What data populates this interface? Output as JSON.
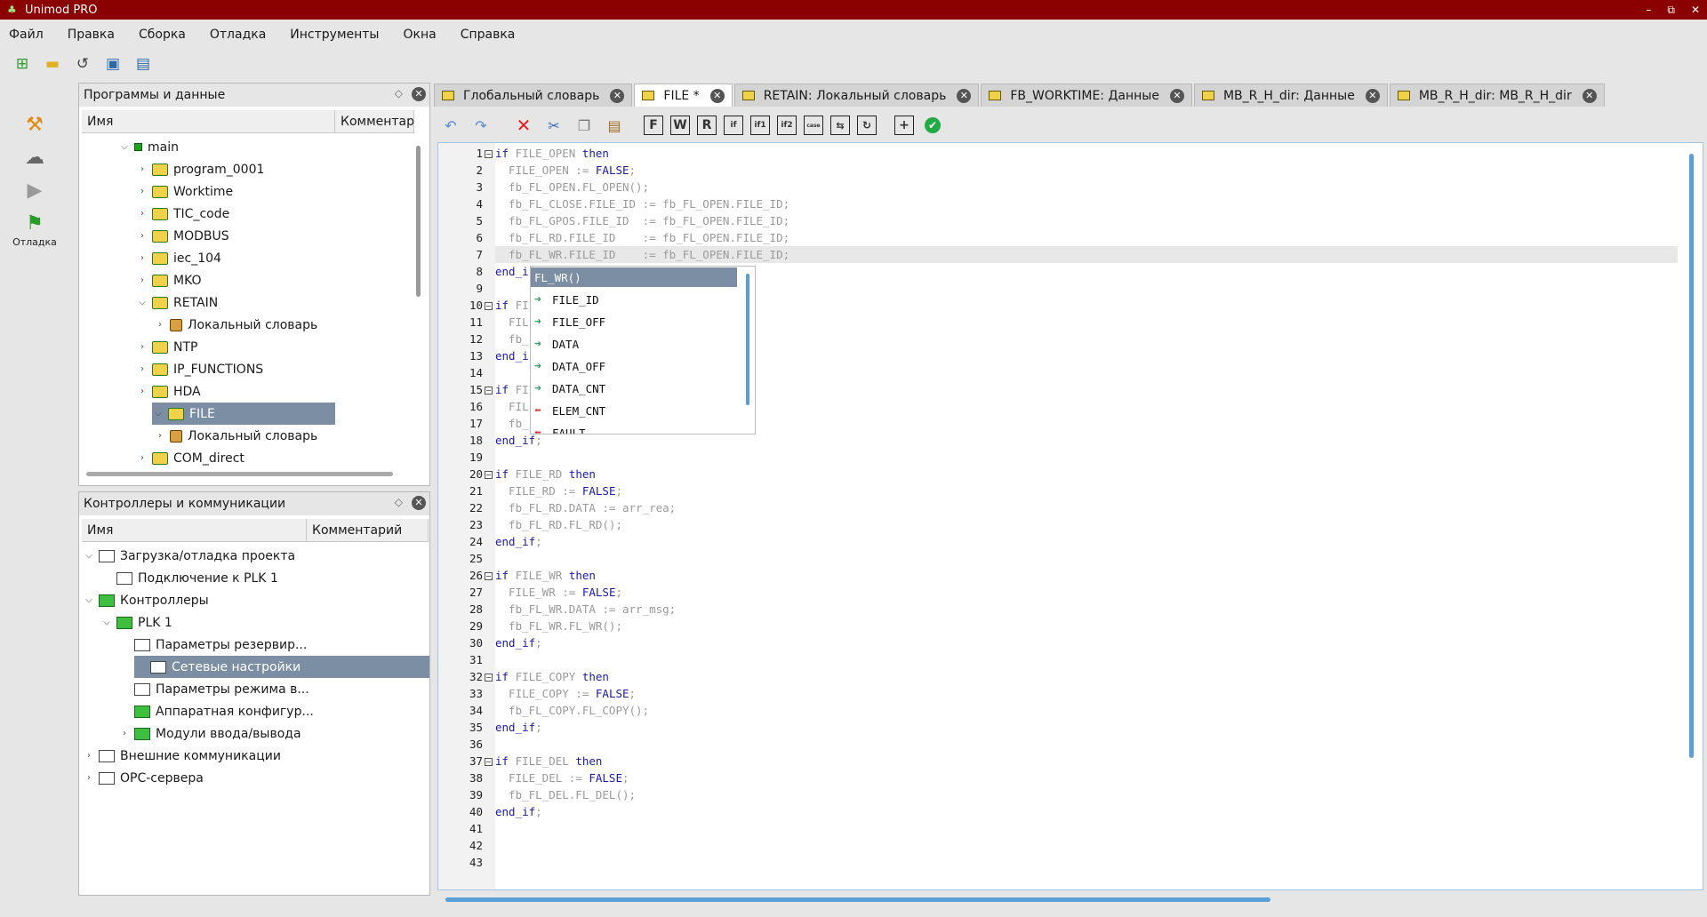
{
  "window": {
    "title": "Unimod PRO",
    "controls": [
      "–",
      "⧉",
      "✕"
    ]
  },
  "menu": [
    "Файл",
    "Правка",
    "Сборка",
    "Отладка",
    "Инструменты",
    "Окна",
    "Справка"
  ],
  "toolbar": {
    "icons": [
      "new-icon",
      "open-folder-icon",
      "history-icon",
      "save-icon",
      "save-all-icon"
    ]
  },
  "leftbar": {
    "debug_label": "Отладка"
  },
  "programs_panel": {
    "title": "Программы и данные",
    "col_name": "Имя",
    "col_comment": "Комментарий",
    "items": [
      {
        "label": "main",
        "level": 0,
        "expanded": true,
        "icon": "green-square"
      },
      {
        "label": "program_0001",
        "level": 1,
        "expanded": false,
        "icon": "folder"
      },
      {
        "label": "Worktime",
        "level": 1,
        "expanded": false,
        "icon": "folder"
      },
      {
        "label": "TIC_code",
        "level": 1,
        "expanded": false,
        "icon": "folder"
      },
      {
        "label": "MODBUS",
        "level": 1,
        "expanded": false,
        "icon": "folder"
      },
      {
        "label": "iec_104",
        "level": 1,
        "expanded": false,
        "icon": "folder"
      },
      {
        "label": "MKO",
        "level": 1,
        "expanded": false,
        "icon": "folder"
      },
      {
        "label": "RETAIN",
        "level": 1,
        "expanded": true,
        "icon": "folder"
      },
      {
        "label": "Локальный словарь",
        "level": 2,
        "expanded": false,
        "icon": "dict"
      },
      {
        "label": "NTP",
        "level": 1,
        "expanded": false,
        "icon": "folder"
      },
      {
        "label": "IP_FUNCTIONS",
        "level": 1,
        "expanded": false,
        "icon": "folder"
      },
      {
        "label": "HDA",
        "level": 1,
        "expanded": false,
        "icon": "folder"
      },
      {
        "label": "FILE",
        "level": 1,
        "expanded": true,
        "icon": "folder",
        "selected": true
      },
      {
        "label": "Локальный словарь",
        "level": 2,
        "expanded": false,
        "icon": "dict"
      },
      {
        "label": "COM_direct",
        "level": 1,
        "expanded": false,
        "icon": "folder"
      }
    ]
  },
  "controllers_panel": {
    "title": "Контроллеры и коммуникации",
    "col_name": "Имя",
    "col_comment": "Комментарий",
    "items": [
      {
        "label": "Загрузка/отладка проекта",
        "level": 0,
        "expanded": true,
        "icon": "doc"
      },
      {
        "label": "Подключение к PLK 1",
        "level": 1,
        "icon": "doc"
      },
      {
        "label": "Контроллеры",
        "level": 0,
        "expanded": true,
        "icon": "green"
      },
      {
        "label": "PLK 1",
        "level": 1,
        "expanded": true,
        "icon": "green"
      },
      {
        "label": "Параметры резервир...",
        "level": 2,
        "icon": "doc"
      },
      {
        "label": "Сетевые настройки",
        "level": 2,
        "icon": "doc",
        "selected": true
      },
      {
        "label": "Параметры режима в...",
        "level": 2,
        "icon": "doc"
      },
      {
        "label": "Аппаратная конфигур...",
        "level": 2,
        "icon": "green"
      },
      {
        "label": "Модули ввода/вывода",
        "level": 2,
        "expanded": false,
        "icon": "green"
      },
      {
        "label": "Внешние коммуникации",
        "level": 0,
        "expanded": false,
        "icon": "doc"
      },
      {
        "label": "OPC-сервера",
        "level": 0,
        "expanded": false,
        "icon": "doc"
      }
    ]
  },
  "tabs": [
    {
      "label": "Глобальный словарь",
      "active": false
    },
    {
      "label": "FILE *",
      "active": true
    },
    {
      "label": "RETAIN: Локальный словарь",
      "active": false
    },
    {
      "label": "FB_WORKTIME: Данные",
      "active": false
    },
    {
      "label": "MB_R_H_dir: Данные",
      "active": false
    },
    {
      "label": "MB_R_H_dir: MB_R_H_dir",
      "active": false
    }
  ],
  "editor_toolbar": [
    "undo-icon",
    "redo-icon",
    "delete-icon",
    "cut-icon",
    "copy-icon",
    "paste-icon",
    "F",
    "W",
    "R",
    "if",
    "if1",
    "if2",
    "case",
    "loop",
    "repeat",
    "add-icon",
    "check-icon"
  ],
  "code": [
    {
      "n": "1",
      "t": [
        [
          "kw",
          "if"
        ],
        [
          "",
          "FILE_OPEN "
        ],
        [
          "kw",
          "then"
        ]
      ],
      "fold": true
    },
    {
      "n": "2",
      "t": [
        [
          "",
          "  FILE_OPEN := "
        ],
        [
          "kw",
          "FALSE"
        ],
        [
          "",
          ";"
        ]
      ]
    },
    {
      "n": "3",
      "t": [
        [
          "",
          "  fb_FL_OPEN.FL_OPEN();"
        ]
      ]
    },
    {
      "n": "4",
      "t": [
        [
          "",
          "  fb_FL_CLOSE.FILE_ID := fb_FL_OPEN.FILE_ID;"
        ]
      ]
    },
    {
      "n": "5",
      "t": [
        [
          "",
          "  fb_FL_GPOS.FILE_ID  := fb_FL_OPEN.FILE_ID;"
        ]
      ]
    },
    {
      "n": "6",
      "t": [
        [
          "",
          "  fb_FL_RD.FILE_ID    := fb_FL_OPEN.FILE_ID;"
        ]
      ]
    },
    {
      "n": "7",
      "t": [
        [
          "",
          "  fb_FL_WR.FILE_ID    := fb_FL_OPEN.FILE_ID;"
        ]
      ],
      "hl": true
    },
    {
      "n": "8",
      "t": [
        [
          "kw",
          "end_i"
        ]
      ]
    },
    {
      "n": "9",
      "t": []
    },
    {
      "n": "10",
      "t": [
        [
          "kw",
          "if"
        ],
        [
          "",
          "FI"
        ]
      ],
      "fold": true
    },
    {
      "n": "11",
      "t": [
        [
          "",
          "  FIL"
        ]
      ]
    },
    {
      "n": "12",
      "t": [
        [
          "",
          "  fb_"
        ]
      ]
    },
    {
      "n": "13",
      "t": [
        [
          "kw",
          "end_i"
        ]
      ]
    },
    {
      "n": "14",
      "t": []
    },
    {
      "n": "15",
      "t": [
        [
          "kw",
          "if"
        ],
        [
          "",
          "FI"
        ]
      ],
      "fold": true
    },
    {
      "n": "16",
      "t": [
        [
          "",
          "  FIL"
        ]
      ]
    },
    {
      "n": "17",
      "t": [
        [
          "",
          "  fb_"
        ]
      ]
    },
    {
      "n": "18",
      "t": [
        [
          "kw",
          "end_if"
        ],
        [
          "",
          ";"
        ]
      ]
    },
    {
      "n": "19",
      "t": []
    },
    {
      "n": "20",
      "t": [
        [
          "kw",
          "if"
        ],
        [
          "",
          "FILE_RD "
        ],
        [
          "kw",
          "then"
        ]
      ],
      "fold": true
    },
    {
      "n": "21",
      "t": [
        [
          "",
          "  FILE_RD := "
        ],
        [
          "kw",
          "FALSE"
        ],
        [
          "",
          ";"
        ]
      ]
    },
    {
      "n": "22",
      "t": [
        [
          "",
          "  fb_FL_RD.DATA := arr_rea;"
        ]
      ]
    },
    {
      "n": "23",
      "t": [
        [
          "",
          "  fb_FL_RD.FL_RD();"
        ]
      ]
    },
    {
      "n": "24",
      "t": [
        [
          "kw",
          "end_if"
        ],
        [
          "",
          ";"
        ]
      ]
    },
    {
      "n": "25",
      "t": []
    },
    {
      "n": "26",
      "t": [
        [
          "kw",
          "if"
        ],
        [
          "",
          "FILE_WR "
        ],
        [
          "kw",
          "then"
        ]
      ],
      "fold": true
    },
    {
      "n": "27",
      "t": [
        [
          "",
          "  FILE_WR := "
        ],
        [
          "kw",
          "FALSE"
        ],
        [
          "",
          ";"
        ]
      ]
    },
    {
      "n": "28",
      "t": [
        [
          "",
          "  fb_FL_WR.DATA := arr_msg;"
        ]
      ]
    },
    {
      "n": "29",
      "t": [
        [
          "",
          "  fb_FL_WR.FL_WR();"
        ]
      ]
    },
    {
      "n": "30",
      "t": [
        [
          "kw",
          "end_if"
        ],
        [
          "",
          ";"
        ]
      ]
    },
    {
      "n": "31",
      "t": []
    },
    {
      "n": "32",
      "t": [
        [
          "kw",
          "if"
        ],
        [
          "",
          "FILE_COPY "
        ],
        [
          "kw",
          "then"
        ]
      ],
      "fold": true
    },
    {
      "n": "33",
      "t": [
        [
          "",
          "  FILE_COPY := "
        ],
        [
          "kw",
          "FALSE"
        ],
        [
          "",
          ";"
        ]
      ]
    },
    {
      "n": "34",
      "t": [
        [
          "",
          "  fb_FL_COPY.FL_COPY();"
        ]
      ]
    },
    {
      "n": "35",
      "t": [
        [
          "kw",
          "end_if"
        ],
        [
          "",
          ";"
        ]
      ]
    },
    {
      "n": "36",
      "t": []
    },
    {
      "n": "37",
      "t": [
        [
          "kw",
          "if"
        ],
        [
          "",
          "FILE_DEL "
        ],
        [
          "kw",
          "then"
        ]
      ],
      "fold": true
    },
    {
      "n": "38",
      "t": [
        [
          "",
          "  FILE_DEL := "
        ],
        [
          "kw",
          "FALSE"
        ],
        [
          "",
          ";"
        ]
      ]
    },
    {
      "n": "39",
      "t": [
        [
          "",
          "  fb_FL_DEL.FL_DEL();"
        ]
      ]
    },
    {
      "n": "40",
      "t": [
        [
          "kw",
          "end_if"
        ],
        [
          "",
          ";"
        ]
      ]
    },
    {
      "n": "41",
      "t": []
    },
    {
      "n": "42",
      "t": []
    },
    {
      "n": "43",
      "t": []
    }
  ],
  "completion": [
    {
      "label": "FL_WR()",
      "kind": "method",
      "selected": true
    },
    {
      "label": "FILE_ID",
      "kind": "in"
    },
    {
      "label": "FILE_OFF",
      "kind": "in"
    },
    {
      "label": "DATA",
      "kind": "in"
    },
    {
      "label": "DATA_OFF",
      "kind": "in"
    },
    {
      "label": "DATA_CNT",
      "kind": "in"
    },
    {
      "label": "ELEM_CNT",
      "kind": "out"
    },
    {
      "label": "FAULT",
      "kind": "out"
    }
  ],
  "colors": {
    "titlebar": "#8b0000",
    "selection": "#7b8ea3",
    "keyword": "#1a1aa6",
    "code_text": "#9a9a9a",
    "scrollbar": "#5aa0d8"
  }
}
